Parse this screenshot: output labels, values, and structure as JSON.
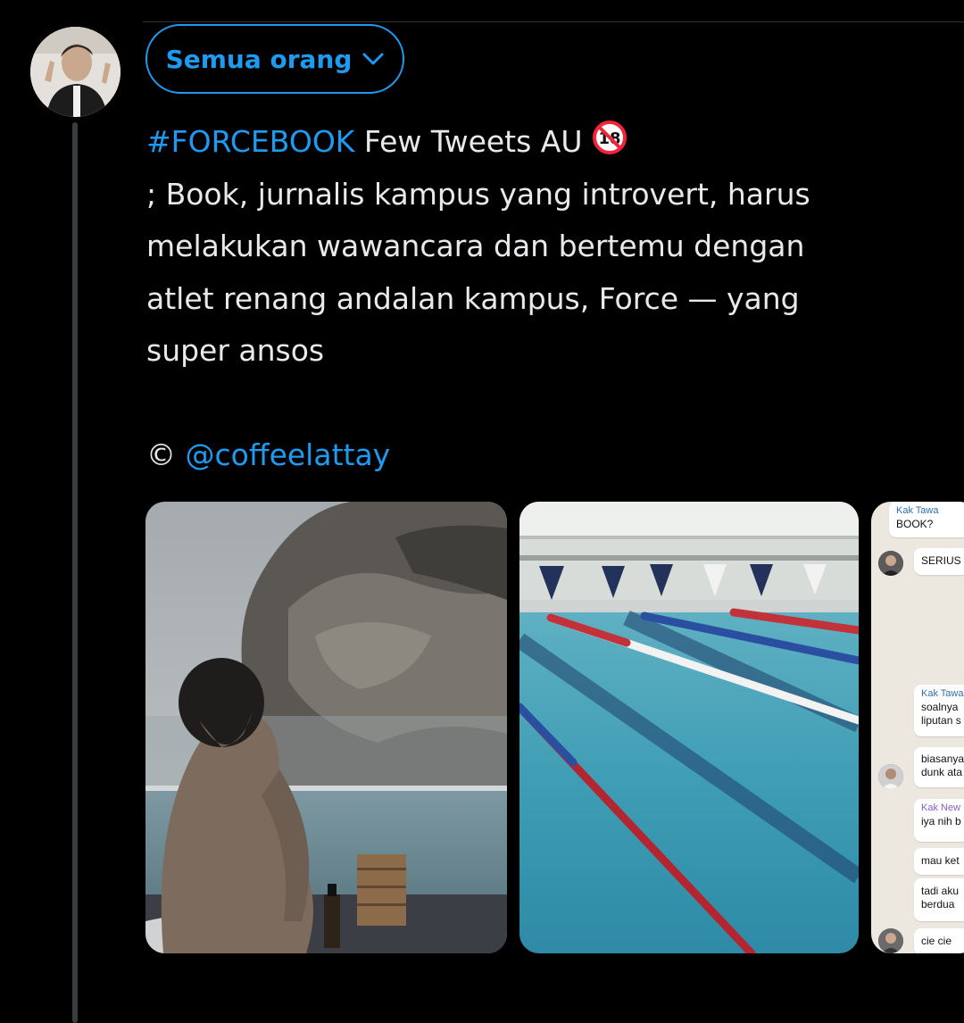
{
  "audience": {
    "label": "Semua orang"
  },
  "tweet": {
    "hashtag": "#FORCEBOOK",
    "title_rest": " Few Tweets AU",
    "lines": [
      "; Book, jurnalis kampus yang introvert, harus",
      "melakukan wawancara dan bertemu dengan",
      "atlet renang andalan kampus, Force — yang",
      "super ansos"
    ],
    "credit_symbol": "©",
    "credit_handle": "@coffeelattay"
  },
  "nsfw_badge": {
    "icon": "no-under-18-icon",
    "text": "18"
  },
  "chat": {
    "messages": [
      {
        "sender": "Kak Tawa",
        "text": "BOOK?"
      },
      {
        "text": "SERIUS"
      },
      {
        "sender": "Kak Tawa",
        "text": "soalnya",
        "text2": "liputan s"
      },
      {
        "text": "biasanya",
        "text2": "dunk ata"
      },
      {
        "sender": "Kak New",
        "text": "iya nih b"
      },
      {
        "text": "mau ket"
      },
      {
        "text": "tadi aku",
        "text2": "berdua"
      },
      {
        "text": "cie cie"
      }
    ]
  },
  "colors": {
    "accent": "#1d9bf0",
    "background": "#000000",
    "text": "#e7e9ea"
  }
}
